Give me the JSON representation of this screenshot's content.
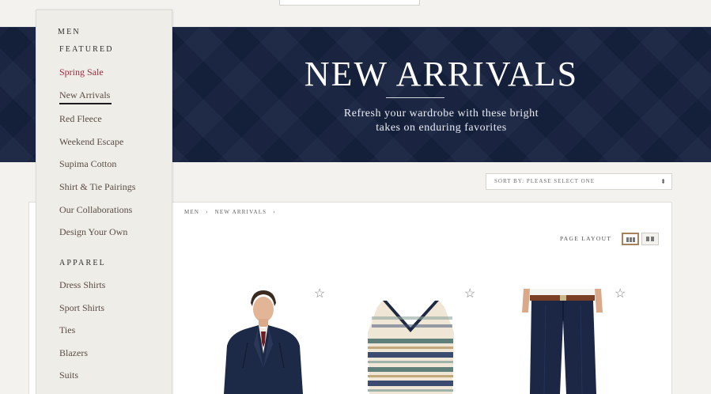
{
  "hero": {
    "title": "NEW ARRIVALS",
    "subtitle_line1": "Refresh your wardrobe with these bright",
    "subtitle_line2": "takes on enduring favorites"
  },
  "sidebar": {
    "section_men": "MEN",
    "section_featured": "FEATURED",
    "featured": [
      "Spring Sale",
      "New Arrivals",
      "Red Fleece",
      "Weekend Escape",
      "Supima Cotton",
      "Shirt & Tie Pairings",
      "Our Collaborations",
      "Design Your Own"
    ],
    "section_apparel": "APPAREL",
    "apparel": [
      "Dress Shirts",
      "Sport Shirts",
      "Ties",
      "Blazers",
      "Suits"
    ]
  },
  "sort": {
    "label": "SORT BY: PLEASE SELECT ONE",
    "arrows_icon": "up-down-arrows-icon"
  },
  "breadcrumb": {
    "items": [
      "MEN",
      "NEW ARRIVALS"
    ],
    "separator": "›"
  },
  "page_layout": {
    "label": "PAGE LAYOUT",
    "options": [
      "three-column-grid-icon",
      "two-column-grid-icon"
    ],
    "selected": "three-column-grid-icon"
  },
  "products": [
    {
      "image": "navy-blazer-outfit",
      "favorite_icon": "star-icon",
      "favorite_glyph": "☆"
    },
    {
      "image": "fair-isle-sweater-vest",
      "favorite_icon": "star-icon",
      "favorite_glyph": "☆"
    },
    {
      "image": "navy-trousers-with-belt",
      "favorite_icon": "star-icon",
      "favorite_glyph": "☆"
    }
  ],
  "colors": {
    "hero_navy": "#16223f",
    "sale_red": "#9b2a3c",
    "layout_selected_border": "#a6835c"
  }
}
